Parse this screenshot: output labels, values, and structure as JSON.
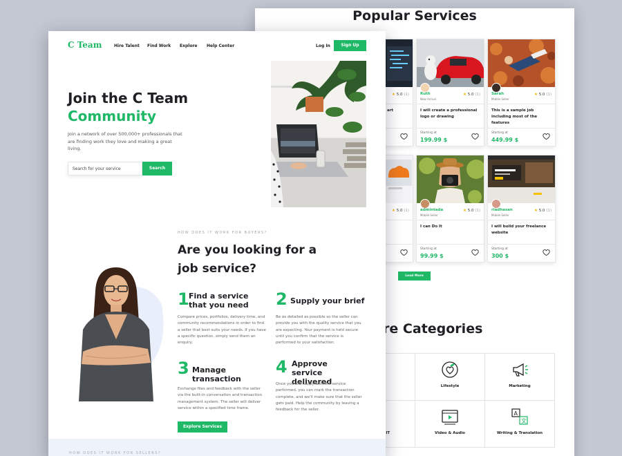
{
  "back": {
    "popular_title": "Popular Services",
    "cards": [
      {
        "name": "",
        "role": "",
        "rating": "5.0",
        "count": "(1)",
        "desc": "art",
        "start": "Starting at",
        "price": ""
      },
      {
        "name": "Ruth",
        "role": "New Arrival",
        "rating": "5.0",
        "count": "(1)",
        "desc": "I will create a professional logo or drawing",
        "start": "Starting at",
        "price": "199.99 $"
      },
      {
        "name": "Sarah",
        "role": "Mobile Seller",
        "rating": "5.0",
        "count": "(1)",
        "desc": "This is a sample job including most of the features",
        "start": "Starting at",
        "price": "449.99 $"
      },
      {
        "name": "",
        "role": "",
        "rating": "5.0",
        "count": "(1)",
        "desc": "",
        "start": "",
        "price": ""
      },
      {
        "name": "admintada",
        "role": "Mobile Seller",
        "rating": "5.0",
        "count": "(1)",
        "desc": "I can Do It",
        "start": "Starting at",
        "price": "99.99 $"
      },
      {
        "name": "riadhasan",
        "role": "Mobile Seller",
        "rating": "5.0",
        "count": "(1)",
        "desc": "I will build your freelance website",
        "start": "Starting at",
        "price": "300 $"
      }
    ],
    "load_more": "Load More",
    "categories_title": "ore Categories",
    "categories": [
      {
        "label": "esign",
        "icon": "pen-icon"
      },
      {
        "label": "Lifestyle",
        "icon": "heart-leaf-icon"
      },
      {
        "label": "Marketing",
        "icon": "megaphone-icon"
      },
      {
        "label": "ing & IT",
        "icon": "code-icon"
      },
      {
        "label": "Video & Audio",
        "icon": "video-player-icon"
      },
      {
        "label": "Writing & Translation",
        "icon": "translate-icon"
      }
    ]
  },
  "front": {
    "logo": "C Team",
    "nav": [
      "Hire Talent",
      "Find Work",
      "Explore",
      "Help Center"
    ],
    "login": "Log In",
    "signup": "Sign Up",
    "hero_line1": "Join the C Team",
    "hero_line2": "Community",
    "hero_sub": "Join a network of over 500,000+ professionals that are finding work they love and making a great living.",
    "search_placeholder": "Search for your service",
    "search_button": "Search",
    "how_eyebrow": "HOW DOES IT WORK FOR BUYERS?",
    "how_title": "Are you looking for a job service?",
    "steps": [
      {
        "num": "1",
        "title": "Find a service that you need",
        "text": "Compare prices, portfolios, delivery time, and community recommendations in order to find a seller that best suits your needs. If you have a specific question, simply send them an enquiry."
      },
      {
        "num": "2",
        "title": "Supply your brief",
        "text": "Be as detailed as possible so the seller can provide you with the quality service that you are expecting. Your payment is held secure until you confirm that the service is performed to your satisfaction."
      },
      {
        "num": "3",
        "title": "Manage transaction",
        "text": "Exchange files and feedback with the seller via the built-in conversation and transaction management system. The seller will deliver service within a specified time frame."
      },
      {
        "num": "4",
        "title": "Approve service delivered",
        "text": "Once you are happy with the service performed, you can mark the transaction complete, and we'll make sure that the seller gets paid. Help the community by leaving a feedback for the seller."
      }
    ],
    "explore_button": "Explore Services",
    "sellers_eyebrow": "HOW DOES IT WORK FOR SELLERS?"
  },
  "colors": {
    "accent": "#1fb866",
    "background": "#c4c8d2",
    "star": "#f5b400"
  }
}
